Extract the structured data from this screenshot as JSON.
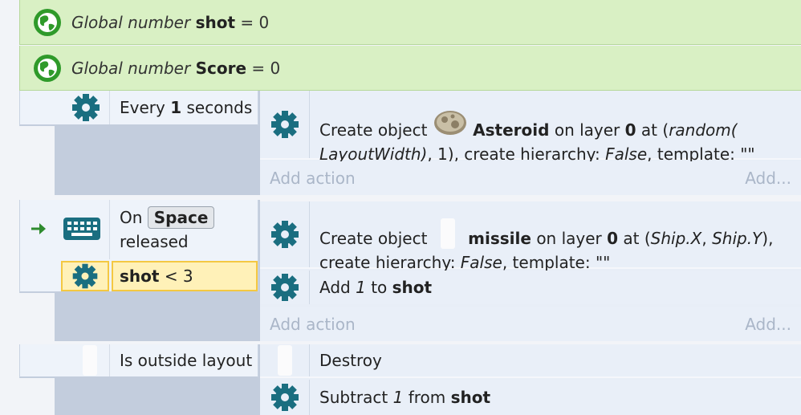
{
  "globals": [
    {
      "prefix": "Global number",
      "name": "shot",
      "suffix": "= 0"
    },
    {
      "prefix": "Global number",
      "name": "Score",
      "suffix": "= 0"
    }
  ],
  "event1": {
    "condition": {
      "pre": "Every",
      "value": "1",
      "post": "seconds"
    },
    "action": {
      "pre": "Create object",
      "object": "Asteroid",
      "mid1": "on layer",
      "layer": "0",
      "mid2": "at (",
      "expr1": "random( LayoutWidth)",
      "mid3": ", 1), create hierarchy:",
      "hier": "False",
      "mid4": ", template: \"\""
    },
    "add_action": "Add action",
    "add_more": "Add..."
  },
  "event2": {
    "trigger": {
      "pre": "On",
      "key": "Space",
      "post": "released"
    },
    "condition2": {
      "var": "shot",
      "op": "< 3"
    },
    "action1": {
      "pre": "Create object",
      "object": "missile",
      "mid1": "on layer",
      "layer": "0",
      "mid2": "at (",
      "expr1": "Ship.X",
      "sep": ", ",
      "expr2": "Ship.Y",
      "mid3": "), create hierarchy:",
      "hier": "False",
      "mid4": ", template: \"\""
    },
    "action2": {
      "pre": "Add",
      "num": "1",
      "mid": "to",
      "var": "shot"
    },
    "add_action": "Add action",
    "add_more": "Add..."
  },
  "event3": {
    "condition": {
      "label": "Is outside layout"
    },
    "action1": {
      "label": "Destroy"
    },
    "action2": {
      "pre": "Subtract",
      "num": "1",
      "mid": "from",
      "var": "shot"
    }
  },
  "colors": {
    "gear": "#1a6e80",
    "globe": "#2f9a2a",
    "global_bg": "#d9f0c4",
    "arrow": "#2e8b2e",
    "highlight": "#fff1b8"
  },
  "icons": [
    "globe-icon",
    "gear-icon",
    "keyboard-icon",
    "trigger-arrow-icon",
    "asteroid-icon",
    "missile-sprite-icon"
  ]
}
